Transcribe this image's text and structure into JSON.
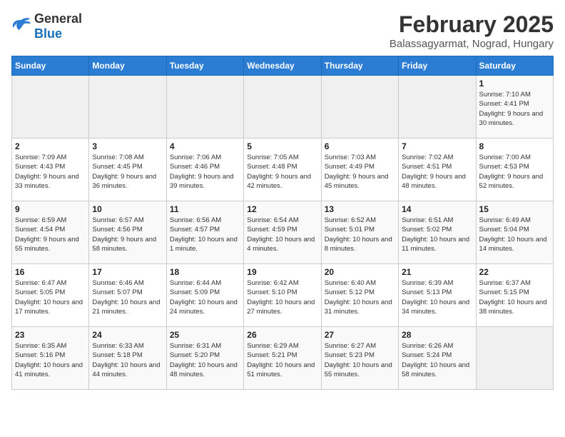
{
  "header": {
    "logo_general": "General",
    "logo_blue": "Blue",
    "title": "February 2025",
    "subtitle": "Balassagyarmat, Nograd, Hungary"
  },
  "days_of_week": [
    "Sunday",
    "Monday",
    "Tuesday",
    "Wednesday",
    "Thursday",
    "Friday",
    "Saturday"
  ],
  "weeks": [
    [
      {
        "day": "",
        "info": ""
      },
      {
        "day": "",
        "info": ""
      },
      {
        "day": "",
        "info": ""
      },
      {
        "day": "",
        "info": ""
      },
      {
        "day": "",
        "info": ""
      },
      {
        "day": "",
        "info": ""
      },
      {
        "day": "1",
        "info": "Sunrise: 7:10 AM\nSunset: 4:41 PM\nDaylight: 9 hours and 30 minutes."
      }
    ],
    [
      {
        "day": "2",
        "info": "Sunrise: 7:09 AM\nSunset: 4:43 PM\nDaylight: 9 hours and 33 minutes."
      },
      {
        "day": "3",
        "info": "Sunrise: 7:08 AM\nSunset: 4:45 PM\nDaylight: 9 hours and 36 minutes."
      },
      {
        "day": "4",
        "info": "Sunrise: 7:06 AM\nSunset: 4:46 PM\nDaylight: 9 hours and 39 minutes."
      },
      {
        "day": "5",
        "info": "Sunrise: 7:05 AM\nSunset: 4:48 PM\nDaylight: 9 hours and 42 minutes."
      },
      {
        "day": "6",
        "info": "Sunrise: 7:03 AM\nSunset: 4:49 PM\nDaylight: 9 hours and 45 minutes."
      },
      {
        "day": "7",
        "info": "Sunrise: 7:02 AM\nSunset: 4:51 PM\nDaylight: 9 hours and 48 minutes."
      },
      {
        "day": "8",
        "info": "Sunrise: 7:00 AM\nSunset: 4:53 PM\nDaylight: 9 hours and 52 minutes."
      }
    ],
    [
      {
        "day": "9",
        "info": "Sunrise: 6:59 AM\nSunset: 4:54 PM\nDaylight: 9 hours and 55 minutes."
      },
      {
        "day": "10",
        "info": "Sunrise: 6:57 AM\nSunset: 4:56 PM\nDaylight: 9 hours and 58 minutes."
      },
      {
        "day": "11",
        "info": "Sunrise: 6:56 AM\nSunset: 4:57 PM\nDaylight: 10 hours and 1 minute."
      },
      {
        "day": "12",
        "info": "Sunrise: 6:54 AM\nSunset: 4:59 PM\nDaylight: 10 hours and 4 minutes."
      },
      {
        "day": "13",
        "info": "Sunrise: 6:52 AM\nSunset: 5:01 PM\nDaylight: 10 hours and 8 minutes."
      },
      {
        "day": "14",
        "info": "Sunrise: 6:51 AM\nSunset: 5:02 PM\nDaylight: 10 hours and 11 minutes."
      },
      {
        "day": "15",
        "info": "Sunrise: 6:49 AM\nSunset: 5:04 PM\nDaylight: 10 hours and 14 minutes."
      }
    ],
    [
      {
        "day": "16",
        "info": "Sunrise: 6:47 AM\nSunset: 5:05 PM\nDaylight: 10 hours and 17 minutes."
      },
      {
        "day": "17",
        "info": "Sunrise: 6:46 AM\nSunset: 5:07 PM\nDaylight: 10 hours and 21 minutes."
      },
      {
        "day": "18",
        "info": "Sunrise: 6:44 AM\nSunset: 5:09 PM\nDaylight: 10 hours and 24 minutes."
      },
      {
        "day": "19",
        "info": "Sunrise: 6:42 AM\nSunset: 5:10 PM\nDaylight: 10 hours and 27 minutes."
      },
      {
        "day": "20",
        "info": "Sunrise: 6:40 AM\nSunset: 5:12 PM\nDaylight: 10 hours and 31 minutes."
      },
      {
        "day": "21",
        "info": "Sunrise: 6:39 AM\nSunset: 5:13 PM\nDaylight: 10 hours and 34 minutes."
      },
      {
        "day": "22",
        "info": "Sunrise: 6:37 AM\nSunset: 5:15 PM\nDaylight: 10 hours and 38 minutes."
      }
    ],
    [
      {
        "day": "23",
        "info": "Sunrise: 6:35 AM\nSunset: 5:16 PM\nDaylight: 10 hours and 41 minutes."
      },
      {
        "day": "24",
        "info": "Sunrise: 6:33 AM\nSunset: 5:18 PM\nDaylight: 10 hours and 44 minutes."
      },
      {
        "day": "25",
        "info": "Sunrise: 6:31 AM\nSunset: 5:20 PM\nDaylight: 10 hours and 48 minutes."
      },
      {
        "day": "26",
        "info": "Sunrise: 6:29 AM\nSunset: 5:21 PM\nDaylight: 10 hours and 51 minutes."
      },
      {
        "day": "27",
        "info": "Sunrise: 6:27 AM\nSunset: 5:23 PM\nDaylight: 10 hours and 55 minutes."
      },
      {
        "day": "28",
        "info": "Sunrise: 6:26 AM\nSunset: 5:24 PM\nDaylight: 10 hours and 58 minutes."
      },
      {
        "day": "",
        "info": ""
      }
    ]
  ]
}
